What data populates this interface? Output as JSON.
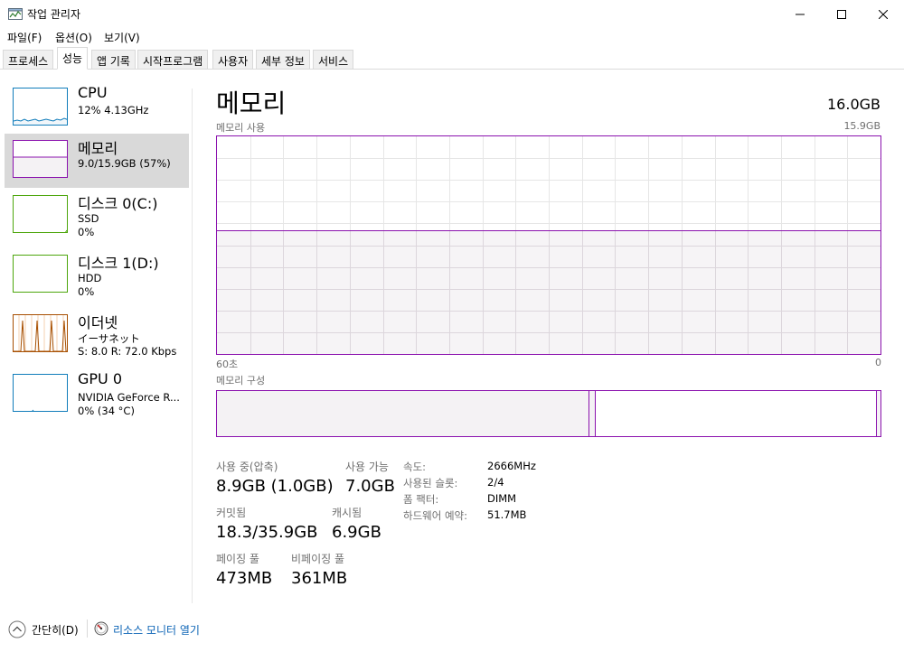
{
  "window": {
    "title": "작업 관리자",
    "min_glyph": "—",
    "max_glyph": "☐",
    "close_glyph": "✕"
  },
  "menu": [
    "파일(F)",
    "옵션(O)",
    "보기(V)"
  ],
  "tabs": [
    "프로세스",
    "성능",
    "앱 기록",
    "시작프로그램",
    "사용자",
    "세부 정보",
    "서비스"
  ],
  "active_tab": 1,
  "sidebar": {
    "items": [
      {
        "title": "CPU",
        "sub1": "12% 4.13GHz",
        "sub2": "",
        "color": "#117dbb",
        "fill": "#f1f6fa"
      },
      {
        "title": "메모리",
        "sub1": "9.0/15.9GB (57%)",
        "sub2": "",
        "color": "#8b12ae",
        "fill": "#f4f2f4"
      },
      {
        "title": "디스크 0(C:)",
        "sub1": "SSD",
        "sub2": "0%",
        "color": "#4da60c",
        "fill": "#eff7ea"
      },
      {
        "title": "디스크 1(D:)",
        "sub1": "HDD",
        "sub2": "0%",
        "color": "#4da60c",
        "fill": "#eff7ea"
      },
      {
        "title": "이더넷",
        "sub1": "イーサネット",
        "sub2": "S: 8.0  R: 72.0 Kbps",
        "color": "#a74f01",
        "fill": "#fcf3eb"
      },
      {
        "title": "GPU 0",
        "sub1": "NVIDIA GeForce R...",
        "sub2": "0% (34 °C)",
        "color": "#117dbb",
        "fill": "#f1f6fa"
      }
    ]
  },
  "main": {
    "title": "메모리",
    "total": "16.0GB",
    "usage_label": "메모리 사용",
    "usage_max": "15.9GB",
    "axis_left": "60초",
    "axis_right": "0",
    "composition_label": "메모리 구성",
    "usage_fraction": 0.57,
    "composition": {
      "in_use_fraction": 0.56,
      "modified_fraction": 0.008,
      "free_fraction": 0.006
    },
    "colors": {
      "accent": "#8b12ae",
      "fill": "#f4f2f4",
      "grid": "#e6e6e6"
    }
  },
  "stats": {
    "in_use_label": "사용 중(압축)",
    "in_use_value": "8.9GB (1.0GB)",
    "available_label": "사용 가능",
    "available_value": "7.0GB",
    "committed_label": "커밋됨",
    "committed_value": "18.3/35.9GB",
    "cached_label": "캐시됨",
    "cached_value": "6.9GB",
    "paged_label": "페이징 풀",
    "paged_value": "473MB",
    "nonpaged_label": "비페이징 풀",
    "nonpaged_value": "361MB"
  },
  "details": [
    {
      "label": "속도:",
      "value": "2666MHz"
    },
    {
      "label": "사용된 슬롯:",
      "value": "2/4"
    },
    {
      "label": "폼 팩터:",
      "value": "DIMM"
    },
    {
      "label": "하드웨어 예약:",
      "value": "51.7MB"
    }
  ],
  "footer": {
    "collapse_label": "간단히(D)",
    "resmon_label": "리소스 모니터 열기"
  }
}
